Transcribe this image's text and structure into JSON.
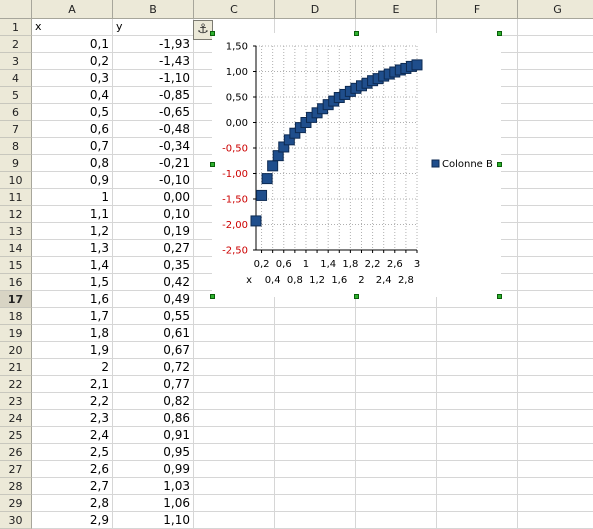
{
  "columns": [
    "A",
    "B",
    "C",
    "D",
    "E",
    "F",
    "G"
  ],
  "rows": [
    {
      "n": "1",
      "a": "x",
      "b": "y"
    },
    {
      "n": "2",
      "a": "0,1",
      "b": "-1,93"
    },
    {
      "n": "3",
      "a": "0,2",
      "b": "-1,43"
    },
    {
      "n": "4",
      "a": "0,3",
      "b": "-1,10"
    },
    {
      "n": "5",
      "a": "0,4",
      "b": "-0,85"
    },
    {
      "n": "6",
      "a": "0,5",
      "b": "-0,65"
    },
    {
      "n": "7",
      "a": "0,6",
      "b": "-0,48"
    },
    {
      "n": "8",
      "a": "0,7",
      "b": "-0,34"
    },
    {
      "n": "9",
      "a": "0,8",
      "b": "-0,21"
    },
    {
      "n": "10",
      "a": "0,9",
      "b": "-0,10"
    },
    {
      "n": "11",
      "a": "1",
      "b": "0,00"
    },
    {
      "n": "12",
      "a": "1,1",
      "b": "0,10"
    },
    {
      "n": "13",
      "a": "1,2",
      "b": "0,19"
    },
    {
      "n": "14",
      "a": "1,3",
      "b": "0,27"
    },
    {
      "n": "15",
      "a": "1,4",
      "b": "0,35"
    },
    {
      "n": "16",
      "a": "1,5",
      "b": "0,42"
    },
    {
      "n": "17",
      "a": "1,6",
      "b": "0,49"
    },
    {
      "n": "18",
      "a": "1,7",
      "b": "0,55"
    },
    {
      "n": "19",
      "a": "1,8",
      "b": "0,61"
    },
    {
      "n": "20",
      "a": "1,9",
      "b": "0,67"
    },
    {
      "n": "21",
      "a": "2",
      "b": "0,72"
    },
    {
      "n": "22",
      "a": "2,1",
      "b": "0,77"
    },
    {
      "n": "23",
      "a": "2,2",
      "b": "0,82"
    },
    {
      "n": "24",
      "a": "2,3",
      "b": "0,86"
    },
    {
      "n": "25",
      "a": "2,4",
      "b": "0,91"
    },
    {
      "n": "26",
      "a": "2,5",
      "b": "0,95"
    },
    {
      "n": "27",
      "a": "2,6",
      "b": "0,99"
    },
    {
      "n": "28",
      "a": "2,7",
      "b": "1,03"
    },
    {
      "n": "29",
      "a": "2,8",
      "b": "1,06"
    },
    {
      "n": "30",
      "a": "2,9",
      "b": "1,10"
    }
  ],
  "selected_row": "17",
  "anchor_icon": "anchor-icon",
  "chart_data": {
    "type": "scatter",
    "x": [
      0.1,
      0.2,
      0.3,
      0.4,
      0.5,
      0.6,
      0.7,
      0.8,
      0.9,
      1.0,
      1.1,
      1.2,
      1.3,
      1.4,
      1.5,
      1.6,
      1.7,
      1.8,
      1.9,
      2.0,
      2.1,
      2.2,
      2.3,
      2.4,
      2.5,
      2.6,
      2.7,
      2.8,
      2.9,
      3.0
    ],
    "series": [
      {
        "name": "Colonne B",
        "values": [
          -1.93,
          -1.43,
          -1.1,
          -0.85,
          -0.65,
          -0.48,
          -0.34,
          -0.21,
          -0.1,
          0.0,
          0.1,
          0.19,
          0.27,
          0.35,
          0.42,
          0.49,
          0.55,
          0.61,
          0.67,
          0.72,
          0.77,
          0.82,
          0.86,
          0.91,
          0.95,
          0.99,
          1.03,
          1.06,
          1.1,
          1.13
        ],
        "color": "#1f4e8c"
      }
    ],
    "xlabel": "x",
    "xlim": [
      0.1,
      3
    ],
    "ylim": [
      -2.5,
      1.5
    ],
    "x_ticks_row1": [
      "0,2",
      "0,6",
      "1",
      "1,4",
      "1,8",
      "2,2",
      "2,6",
      "3"
    ],
    "x_ticks_row2": [
      "0,4",
      "0,8",
      "1,2",
      "1,6",
      "2",
      "2,4",
      "2,8"
    ],
    "y_ticks": [
      "1,50",
      "1,00",
      "0,50",
      "0,00",
      "-0,50",
      "-1,00",
      "-1,50",
      "-2,00",
      "-2,50"
    ],
    "negative_tick_color": "#cc0000",
    "grid": true,
    "legend_position": "right"
  }
}
